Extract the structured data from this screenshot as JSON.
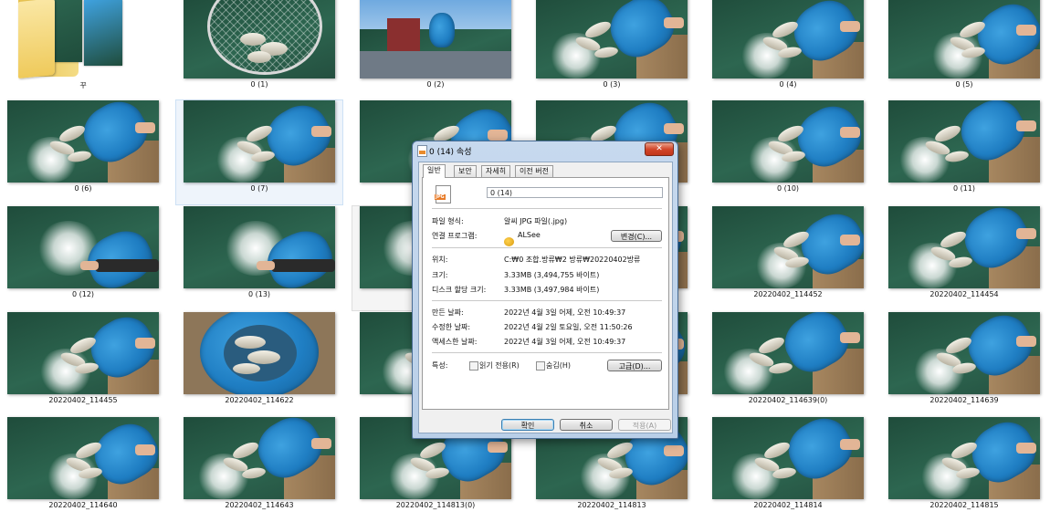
{
  "thumbnails": [
    {
      "label": "꾸",
      "kind": "folder"
    },
    {
      "label": "0 (1)",
      "kind": "net"
    },
    {
      "label": "0 (2)",
      "kind": "shore"
    },
    {
      "label": "0 (3)",
      "kind": "pour"
    },
    {
      "label": "0 (4)",
      "kind": "pour"
    },
    {
      "label": "0 (5)",
      "kind": "pour"
    },
    {
      "label": "0 (6)",
      "kind": "pour"
    },
    {
      "label": "0 (7)",
      "kind": "pour",
      "selected": true
    },
    {
      "label": "",
      "kind": "pour",
      "hidden_label": true
    },
    {
      "label": "",
      "kind": "pour",
      "hidden_label": true
    },
    {
      "label": "0 (10)",
      "kind": "pour"
    },
    {
      "label": "0 (11)",
      "kind": "pour"
    },
    {
      "label": "0 (12)",
      "kind": "splash"
    },
    {
      "label": "0 (13)",
      "kind": "splash"
    },
    {
      "label": "",
      "kind": "splash",
      "hover": true,
      "hidden_label": true
    },
    {
      "label": "",
      "kind": "pour",
      "hidden_label": true
    },
    {
      "label": "20220402_114452",
      "kind": "pour"
    },
    {
      "label": "20220402_114454",
      "kind": "pour"
    },
    {
      "label": "20220402_114455",
      "kind": "pour"
    },
    {
      "label": "20220402_114622",
      "kind": "topdown"
    },
    {
      "label": "2",
      "kind": "pour"
    },
    {
      "label": "",
      "kind": "pour",
      "hidden_label": true
    },
    {
      "label": "20220402_114639(0)",
      "kind": "pour"
    },
    {
      "label": "20220402_114639",
      "kind": "pour"
    },
    {
      "label": "20220402_114640",
      "kind": "pour"
    },
    {
      "label": "20220402_114643",
      "kind": "pour"
    },
    {
      "label": "20220402_114813(0)",
      "kind": "pour"
    },
    {
      "label": "20220402_114813",
      "kind": "pour"
    },
    {
      "label": "20220402_114814",
      "kind": "pour"
    },
    {
      "label": "20220402_114815",
      "kind": "pour"
    }
  ],
  "dialog": {
    "title": "0 (14) 속성",
    "close_label": "✕",
    "tabs": [
      {
        "label": "일반",
        "active": true
      },
      {
        "label": "보안",
        "active": false
      },
      {
        "label": "자세히",
        "active": false
      },
      {
        "label": "이전 버전",
        "active": false
      }
    ],
    "file_name": "0 (14)",
    "file_icon_text": "JPG",
    "rows": {
      "type_label": "파일 형식:",
      "type_value": "알씨 JPG 파일(.jpg)",
      "opens_label": "연결 프로그램:",
      "opens_value": "ALSee",
      "change_button": "변경(C)...",
      "location_label": "위치:",
      "location_value": "C:₩0 조합.방류₩2 방류₩20220402방류",
      "size_label": "크기:",
      "size_value": "3.33MB (3,494,755 바이트)",
      "disk_label": "디스크 할당 크기:",
      "disk_value": "3.33MB (3,497,984 바이트)",
      "created_label": "만든 날짜:",
      "created_value": "2022년 4월 3일 어제, 오전 10:49:37",
      "modified_label": "수정한 날짜:",
      "modified_value": "2022년 4월 2일 토요일, 오전 11:50:26",
      "accessed_label": "액세스한 날짜:",
      "accessed_value": "2022년 4월 3일 어제, 오전 10:49:37",
      "attr_label": "특성:",
      "readonly_label": "읽기 전용(R)",
      "hidden_label": "숨김(H)",
      "advanced_button": "고급(D)..."
    },
    "buttons": {
      "ok": "확인",
      "cancel": "취소",
      "apply": "적용(A)"
    }
  }
}
